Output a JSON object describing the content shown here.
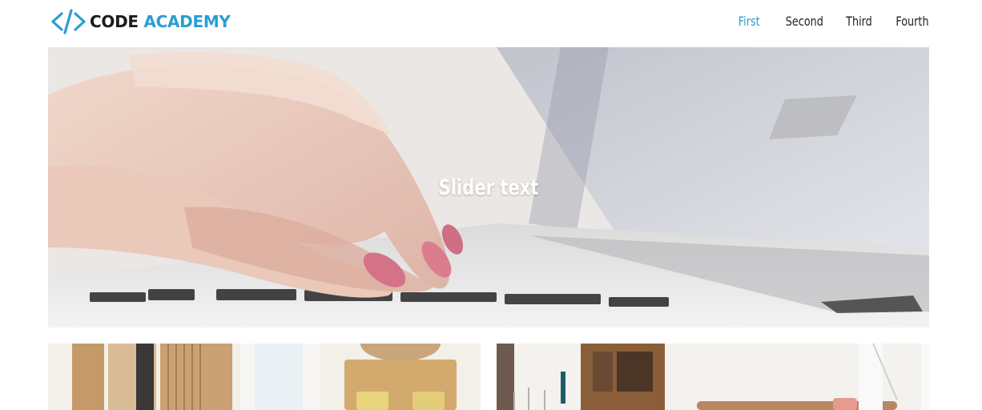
{
  "brand": {
    "code": "CODE",
    "academy": "ACADEMY"
  },
  "nav": [
    {
      "label": "First",
      "active": true
    },
    {
      "label": "Second",
      "active": false
    },
    {
      "label": "Third",
      "active": false
    },
    {
      "label": "Fourth",
      "active": false
    }
  ],
  "slider": {
    "text": "Slider text"
  },
  "colors": {
    "accent": "#2b9dd3",
    "text": "#222222"
  }
}
